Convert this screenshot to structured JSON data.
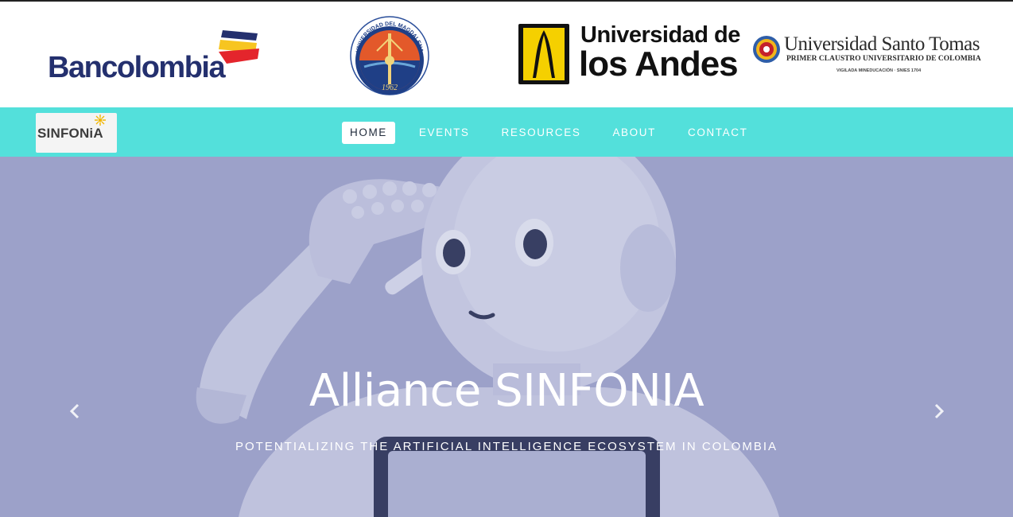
{
  "sponsors": {
    "bancolombia": {
      "name": "Bancolombia"
    },
    "magdalena": {
      "ring_text": "UNIVERSIDAD DEL MAGDALENA",
      "year": "1962"
    },
    "andes": {
      "line1": "Universidad de",
      "line2": "los Andes"
    },
    "santo_tomas": {
      "line1": "Universidad Santo Tomas",
      "line2": "PRIMER CLAUSTRO UNIVERSITARIO DE COLOMBIA",
      "line3": "VIGILADA MINEDUCACIÓN · SNIES 1704"
    }
  },
  "navbar": {
    "brand": "SINFONiA",
    "items": [
      {
        "label": "HOME",
        "active": true
      },
      {
        "label": "EVENTS"
      },
      {
        "label": "RESOURCES"
      },
      {
        "label": "ABOUT"
      },
      {
        "label": "CONTACT"
      }
    ]
  },
  "hero": {
    "title": "Alliance SINFONIA",
    "subtitle": "POTENTIALIZING THE ARTIFICIAL INTELLIGENCE ECOSYSTEM IN COLOMBIA",
    "prev_icon": "chevron-left-icon",
    "next_icon": "chevron-right-icon"
  },
  "colors": {
    "navbar_bg": "#53e0db",
    "hero_overlay": "#9da1ca",
    "bancolombia_navy": "#24306e",
    "bancolombia_yellow": "#f7c520",
    "bancolombia_red": "#e4252c",
    "andes_yellow": "#f5d000"
  }
}
